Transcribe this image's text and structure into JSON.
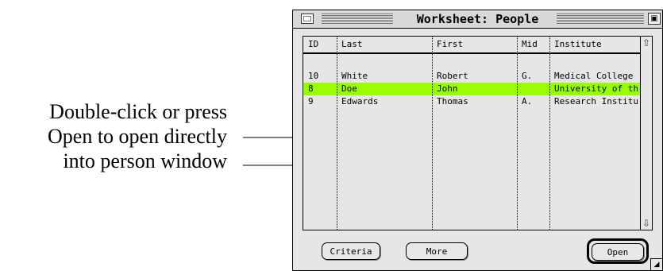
{
  "window": {
    "title": "Worksheet: People",
    "zoom_glyph": "▣"
  },
  "table": {
    "columns": [
      "ID",
      "Last",
      "First",
      "Mid",
      "Institute"
    ],
    "rows": [
      {
        "id": "10",
        "last": "White",
        "first": "Robert",
        "mid": "G.",
        "institute": "Medical College",
        "selected": false
      },
      {
        "id": "8",
        "last": "Doe",
        "first": "John",
        "mid": "",
        "institute": "University of th...",
        "selected": true
      },
      {
        "id": "9",
        "last": "Edwards",
        "first": "Thomas",
        "mid": "A.",
        "institute": "Research Institute",
        "selected": false
      }
    ],
    "selection_color": "#99ff00"
  },
  "buttons": {
    "criteria": "Criteria",
    "more": "More",
    "open": "Open"
  },
  "scrollbar": {
    "up_icon": "arrow-up-icon",
    "down_icon": "arrow-down-icon"
  },
  "callout": {
    "line1": "Double-click or press",
    "line2": "Open to open directly",
    "line3": "into person window"
  }
}
